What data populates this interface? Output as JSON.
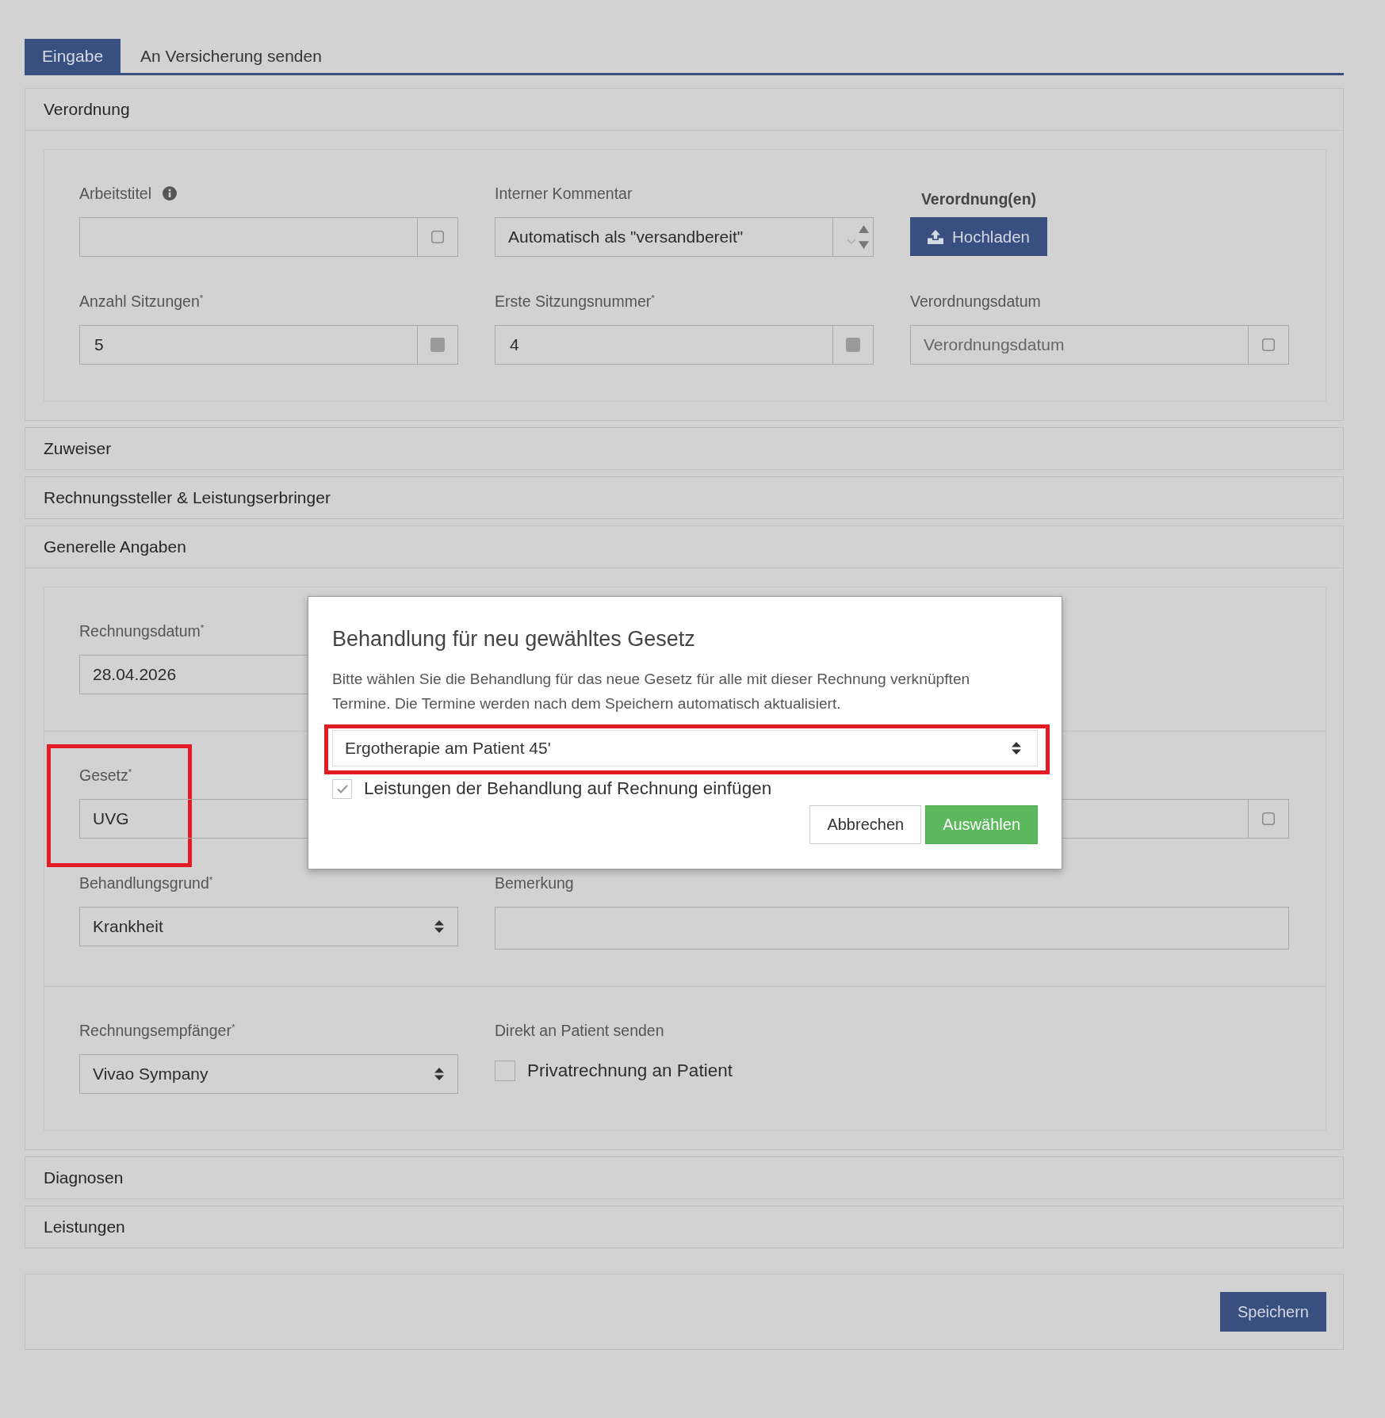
{
  "tabs": [
    {
      "label": "Eingabe",
      "selected": true
    },
    {
      "label": "An Versicherung senden",
      "selected": false
    }
  ],
  "sections": [
    {
      "title": "Verordnung",
      "expanded": true,
      "groups": [
        {
          "rows": [
            [
              {
                "kind": "text",
                "label": "Arbeitstitel",
                "info": true
              },
              {
                "kind": "comment",
                "label": "Interner Kommentar",
                "value": "Automatisch als \"versandbereit\""
              },
              {
                "kind": "upload",
                "label": "Verordnung(en)",
                "button": "Hochladen"
              }
            ],
            [
              {
                "kind": "number",
                "label": "Anzahl Sitzungen$^{*}$",
                "value": "5"
              },
              {
                "kind": "number",
                "label": "Erste Sitzungsnummer$^{*}$",
                "value": "4"
              },
              {
                "kind": "date",
                "label": "Verordnungsdatum",
                "placeholder": "Verordnungsdatum"
              }
            ]
          ]
        }
      ]
    },
    {
      "title": "Zuweiser",
      "expanded": false
    },
    {
      "title": "Rechnungssteller & Leistungserbringer",
      "expanded": false
    },
    {
      "title": "Generelle Angaben",
      "expanded": true,
      "groups": [
        {
          "rows": [
            [
              {
                "kind": "plain",
                "label": "Rechnungsdatum$^{*}$",
                "value": "28.04.2026"
              }
            ]
          ]
        },
        {
          "rows": [
            [
              {
                "kind": "plain",
                "label": "Gesetz$^{*}$",
                "value": "UVG",
                "highlighted": true
              },
              {
                "kind": "date"
              }
            ],
            [
              {
                "kind": "select",
                "label": "Behandlungsgrund$^{*}$",
                "value": "Krankheit"
              },
              {
                "kind": "memo",
                "label": "Bemerkung"
              }
            ]
          ]
        },
        {
          "rows": [
            [
              {
                "kind": "select",
                "label": "Rechnungsempfänger$^{*}$",
                "value": "Vivao Sympany"
              },
              {
                "kind": "checkbox",
                "label": "Direkt an Patient senden",
                "option": "Privatrechnung an Patient",
                "checked": false
              }
            ]
          ]
        }
      ]
    },
    {
      "title": "Diagnosen",
      "expanded": false
    },
    {
      "title": "Leistungen",
      "expanded": false
    }
  ],
  "footer": {
    "buttons": [
      {
        "label": "Speichern",
        "kind": "primary"
      }
    ]
  },
  "dialog": {
    "title": "Behandlung für neu gewähltes Gesetz",
    "text": "Bitte wählen Sie die Behandlung für das neue Gesetz für alle mit dieser Rechnung verknüpften Termine. Die Termine werden nach dem Speichern automatisch aktualisiert.",
    "select": {
      "value": "Ergotherapie am Patient 45'",
      "highlighted": true
    },
    "checkbox": {
      "label": "Leistungen der Behandlung auf Rechnung einfügen",
      "checked": true
    },
    "buttons": [
      {
        "label": "Abbrechen",
        "kind": "secondary"
      },
      {
        "label": "Auswählen",
        "kind": "confirm"
      }
    ]
  }
}
